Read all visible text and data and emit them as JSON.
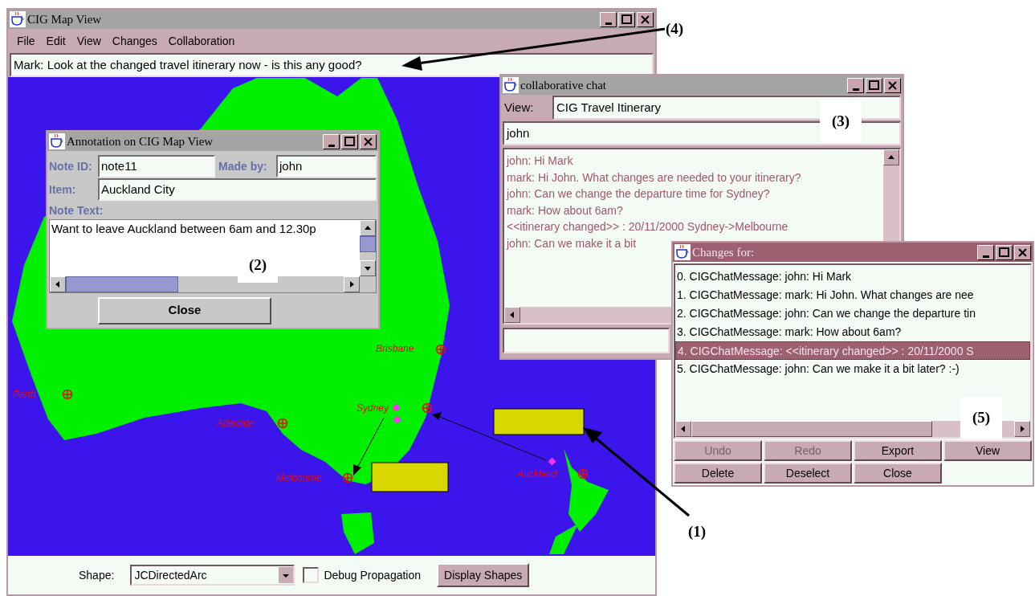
{
  "main_window": {
    "title": "CIG Map View",
    "menu": [
      "File",
      "Edit",
      "View",
      "Changes",
      "Collaboration"
    ],
    "message": "Mark: Look at the changed travel itinerary now - is this any good?",
    "map": {
      "cities": [
        "Brisbane",
        "Perth",
        "Sydney",
        "Adelaide",
        "Melbourne",
        "Auckland"
      ]
    },
    "shape_label": "Shape:",
    "shape_value": "JCDirectedArc",
    "debug": {
      "label": "Debug Propagation",
      "checked": false
    },
    "display_button": "Display Shapes"
  },
  "annotation_window": {
    "title": "Annotation on CIG Map View",
    "note_id_label": "Note ID:",
    "note_id": "note11",
    "made_by_label": "Made by:",
    "made_by": "john",
    "item_label": "Item:",
    "item": "Auckland City",
    "note_text_label": "Note Text:",
    "note_text": "Want to leave Auckland between 6am and 12.30p",
    "close_button": "Close"
  },
  "chat_window": {
    "title": "collaborative chat",
    "view_label": "View:",
    "view": "CIG Travel Itinerary",
    "user": "john",
    "messages": [
      "john: Hi Mark",
      "mark: Hi John. What changes are needed to your itinerary?",
      "john: Can we change the departure time for Sydney?",
      "mark: How about 6am?",
      "<<itinerary changed>> : 20/11/2000 Sydney->Melbourne",
      "john: Can we make it a bit"
    ]
  },
  "changes_window": {
    "title": "Changes for:",
    "items": [
      {
        "text": "0. CIGChatMessage: john: Hi Mark",
        "selected": false
      },
      {
        "text": "1. CIGChatMessage: mark: Hi John. What changes are nee",
        "selected": false
      },
      {
        "text": "2. CIGChatMessage: john: Can we change the departure tin",
        "selected": false
      },
      {
        "text": "3. CIGChatMessage: mark: How about 6am?",
        "selected": false
      },
      {
        "text": "4. CIGChatMessage: <<itinerary changed>> : 20/11/2000 S",
        "selected": true
      },
      {
        "text": "5. CIGChatMessage: john: Can we make it a bit later? :-)",
        "selected": false
      }
    ],
    "buttons": [
      {
        "label": "Undo",
        "disabled": true
      },
      {
        "label": "Redo",
        "disabled": true
      },
      {
        "label": "Export",
        "disabled": false
      },
      {
        "label": "View",
        "disabled": false
      },
      {
        "label": "Delete",
        "disabled": false
      },
      {
        "label": "Deselect",
        "disabled": false
      },
      {
        "label": "Close",
        "disabled": false
      }
    ]
  },
  "callouts": [
    "(1)",
    "(2)",
    "(3)",
    "(4)",
    "(5)"
  ]
}
